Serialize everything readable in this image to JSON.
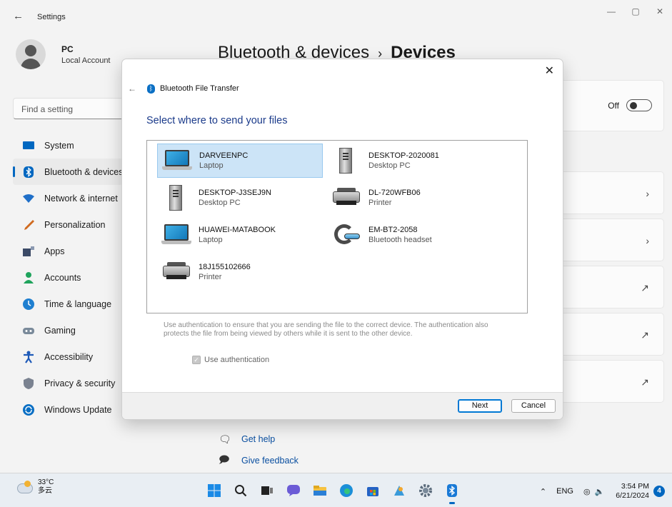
{
  "window": {
    "title": "Settings",
    "controls": [
      "—",
      "▢",
      "✕"
    ]
  },
  "user": {
    "name": "PC",
    "account": "Local Account"
  },
  "search": {
    "placeholder": "Find a setting"
  },
  "nav": [
    {
      "label": "System",
      "icon": "system-icon",
      "color": "#0067c0"
    },
    {
      "label": "Bluetooth & devices",
      "icon": "bluetooth-icon",
      "color": "#0067c0",
      "active": true
    },
    {
      "label": "Network & internet",
      "icon": "network-icon",
      "color": "#1f6fc8"
    },
    {
      "label": "Personalization",
      "icon": "brush-icon",
      "color": "#d06a1f"
    },
    {
      "label": "Apps",
      "icon": "apps-icon",
      "color": "#3b4a66"
    },
    {
      "label": "Accounts",
      "icon": "accounts-icon",
      "color": "#1fa35c"
    },
    {
      "label": "Time & language",
      "icon": "time-language-icon",
      "color": "#1f7fd0"
    },
    {
      "label": "Gaming",
      "icon": "gaming-icon",
      "color": "#7a8a9a"
    },
    {
      "label": "Accessibility",
      "icon": "accessibility-icon",
      "color": "#1e5ab8"
    },
    {
      "label": "Privacy & security",
      "icon": "shield-icon",
      "color": "#7a8290"
    },
    {
      "label": "Windows Update",
      "icon": "update-icon",
      "color": "#0a6fc4"
    }
  ],
  "page": {
    "crumb": "Bluetooth & devices",
    "separator": "›",
    "current": "Devices"
  },
  "cards": {
    "toggle_label": "Off"
  },
  "help": {
    "get_help": "Get help",
    "give_feedback": "Give feedback"
  },
  "dialog": {
    "title": "Bluetooth File Transfer",
    "heading": "Select where to send your files",
    "devices": [
      {
        "name": "DARVEENPC",
        "type": "Laptop",
        "icon": "laptop-icon",
        "selected": true
      },
      {
        "name": "DESKTOP-2020081",
        "type": "Desktop PC",
        "icon": "desktop-icon"
      },
      {
        "name": "DESKTOP-J3SEJ9N",
        "type": "Desktop PC",
        "icon": "desktop-icon"
      },
      {
        "name": "DL-720WFB06",
        "type": "Printer",
        "icon": "printer-icon"
      },
      {
        "name": "HUAWEI-MATABOOK",
        "type": "Laptop",
        "icon": "laptop-icon"
      },
      {
        "name": "EM-BT2-2058",
        "type": "Bluetooth headset",
        "icon": "headset-icon"
      },
      {
        "name": "18J155102666",
        "type": "Printer",
        "icon": "printer-icon"
      }
    ],
    "auth_text": "Use authentication to ensure that you are sending the file to the correct device. The authentication also protects the file from being viewed by others while it is sent to the other device.",
    "auth_label": "Use authentication",
    "auth_checked": true,
    "next_label": "Next",
    "cancel_label": "Cancel"
  },
  "taskbar": {
    "temperature": "33°C",
    "weather_text": "多云",
    "language": "ENG",
    "time": "3:54 PM",
    "date": "6/21/2024",
    "notifications": "4"
  }
}
